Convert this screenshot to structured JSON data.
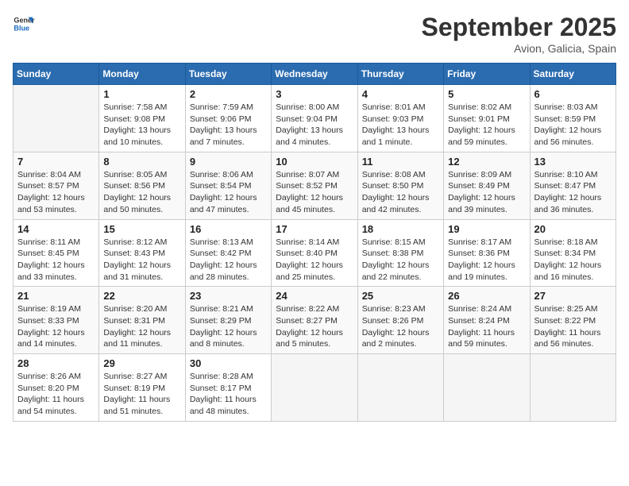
{
  "header": {
    "logo_line1": "General",
    "logo_line2": "Blue",
    "month": "September 2025",
    "location": "Avion, Galicia, Spain"
  },
  "days_of_week": [
    "Sunday",
    "Monday",
    "Tuesday",
    "Wednesday",
    "Thursday",
    "Friday",
    "Saturday"
  ],
  "weeks": [
    [
      {
        "num": "",
        "info": ""
      },
      {
        "num": "1",
        "info": "Sunrise: 7:58 AM\nSunset: 9:08 PM\nDaylight: 13 hours\nand 10 minutes."
      },
      {
        "num": "2",
        "info": "Sunrise: 7:59 AM\nSunset: 9:06 PM\nDaylight: 13 hours\nand 7 minutes."
      },
      {
        "num": "3",
        "info": "Sunrise: 8:00 AM\nSunset: 9:04 PM\nDaylight: 13 hours\nand 4 minutes."
      },
      {
        "num": "4",
        "info": "Sunrise: 8:01 AM\nSunset: 9:03 PM\nDaylight: 13 hours\nand 1 minute."
      },
      {
        "num": "5",
        "info": "Sunrise: 8:02 AM\nSunset: 9:01 PM\nDaylight: 12 hours\nand 59 minutes."
      },
      {
        "num": "6",
        "info": "Sunrise: 8:03 AM\nSunset: 8:59 PM\nDaylight: 12 hours\nand 56 minutes."
      }
    ],
    [
      {
        "num": "7",
        "info": "Sunrise: 8:04 AM\nSunset: 8:57 PM\nDaylight: 12 hours\nand 53 minutes."
      },
      {
        "num": "8",
        "info": "Sunrise: 8:05 AM\nSunset: 8:56 PM\nDaylight: 12 hours\nand 50 minutes."
      },
      {
        "num": "9",
        "info": "Sunrise: 8:06 AM\nSunset: 8:54 PM\nDaylight: 12 hours\nand 47 minutes."
      },
      {
        "num": "10",
        "info": "Sunrise: 8:07 AM\nSunset: 8:52 PM\nDaylight: 12 hours\nand 45 minutes."
      },
      {
        "num": "11",
        "info": "Sunrise: 8:08 AM\nSunset: 8:50 PM\nDaylight: 12 hours\nand 42 minutes."
      },
      {
        "num": "12",
        "info": "Sunrise: 8:09 AM\nSunset: 8:49 PM\nDaylight: 12 hours\nand 39 minutes."
      },
      {
        "num": "13",
        "info": "Sunrise: 8:10 AM\nSunset: 8:47 PM\nDaylight: 12 hours\nand 36 minutes."
      }
    ],
    [
      {
        "num": "14",
        "info": "Sunrise: 8:11 AM\nSunset: 8:45 PM\nDaylight: 12 hours\nand 33 minutes."
      },
      {
        "num": "15",
        "info": "Sunrise: 8:12 AM\nSunset: 8:43 PM\nDaylight: 12 hours\nand 31 minutes."
      },
      {
        "num": "16",
        "info": "Sunrise: 8:13 AM\nSunset: 8:42 PM\nDaylight: 12 hours\nand 28 minutes."
      },
      {
        "num": "17",
        "info": "Sunrise: 8:14 AM\nSunset: 8:40 PM\nDaylight: 12 hours\nand 25 minutes."
      },
      {
        "num": "18",
        "info": "Sunrise: 8:15 AM\nSunset: 8:38 PM\nDaylight: 12 hours\nand 22 minutes."
      },
      {
        "num": "19",
        "info": "Sunrise: 8:17 AM\nSunset: 8:36 PM\nDaylight: 12 hours\nand 19 minutes."
      },
      {
        "num": "20",
        "info": "Sunrise: 8:18 AM\nSunset: 8:34 PM\nDaylight: 12 hours\nand 16 minutes."
      }
    ],
    [
      {
        "num": "21",
        "info": "Sunrise: 8:19 AM\nSunset: 8:33 PM\nDaylight: 12 hours\nand 14 minutes."
      },
      {
        "num": "22",
        "info": "Sunrise: 8:20 AM\nSunset: 8:31 PM\nDaylight: 12 hours\nand 11 minutes."
      },
      {
        "num": "23",
        "info": "Sunrise: 8:21 AM\nSunset: 8:29 PM\nDaylight: 12 hours\nand 8 minutes."
      },
      {
        "num": "24",
        "info": "Sunrise: 8:22 AM\nSunset: 8:27 PM\nDaylight: 12 hours\nand 5 minutes."
      },
      {
        "num": "25",
        "info": "Sunrise: 8:23 AM\nSunset: 8:26 PM\nDaylight: 12 hours\nand 2 minutes."
      },
      {
        "num": "26",
        "info": "Sunrise: 8:24 AM\nSunset: 8:24 PM\nDaylight: 11 hours\nand 59 minutes."
      },
      {
        "num": "27",
        "info": "Sunrise: 8:25 AM\nSunset: 8:22 PM\nDaylight: 11 hours\nand 56 minutes."
      }
    ],
    [
      {
        "num": "28",
        "info": "Sunrise: 8:26 AM\nSunset: 8:20 PM\nDaylight: 11 hours\nand 54 minutes."
      },
      {
        "num": "29",
        "info": "Sunrise: 8:27 AM\nSunset: 8:19 PM\nDaylight: 11 hours\nand 51 minutes."
      },
      {
        "num": "30",
        "info": "Sunrise: 8:28 AM\nSunset: 8:17 PM\nDaylight: 11 hours\nand 48 minutes."
      },
      {
        "num": "",
        "info": ""
      },
      {
        "num": "",
        "info": ""
      },
      {
        "num": "",
        "info": ""
      },
      {
        "num": "",
        "info": ""
      }
    ]
  ]
}
